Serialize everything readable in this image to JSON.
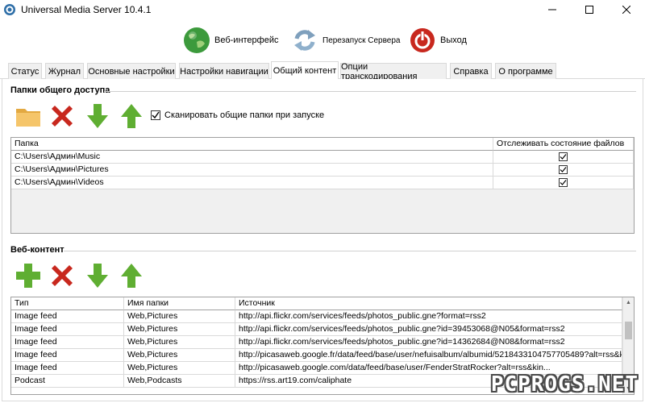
{
  "window": {
    "title": "Universal Media Server 10.4.1",
    "app_icon": "ums-icon"
  },
  "toolbar": {
    "web_label": "Веб-интерфейс",
    "restart_label": "Перезапуск Сервера",
    "exit_label": "Выход"
  },
  "tabs": [
    {
      "label": "Статус"
    },
    {
      "label": "Журнал"
    },
    {
      "label": "Основные настройки"
    },
    {
      "label": "Настройки навигации"
    },
    {
      "label": "Общий контент"
    },
    {
      "label": "Опции транскодирования"
    },
    {
      "label": "Справка"
    },
    {
      "label": "О программе"
    }
  ],
  "active_tab": "Общий контент",
  "shared_folders": {
    "section_title": "Папки общего доступа",
    "scan_label": "Сканировать общие папки при запуске",
    "scan_checked": true,
    "columns": [
      "Папка",
      "Отслеживать состояние файлов"
    ],
    "rows": [
      {
        "folder": "C:\\Users\\Админ\\Music",
        "monitor": true
      },
      {
        "folder": "C:\\Users\\Админ\\Pictures",
        "monitor": true
      },
      {
        "folder": "C:\\Users\\Админ\\Videos",
        "monitor": true
      }
    ]
  },
  "web_content": {
    "section_title": "Веб-контент",
    "columns": [
      "Тип",
      "Имя папки",
      "Источник"
    ],
    "rows": [
      {
        "type": "Image feed",
        "folder": "Web,Pictures",
        "source": "http://api.flickr.com/services/feeds/photos_public.gne?format=rss2"
      },
      {
        "type": "Image feed",
        "folder": "Web,Pictures",
        "source": "http://api.flickr.com/services/feeds/photos_public.gne?id=39453068@N05&format=rss2"
      },
      {
        "type": "Image feed",
        "folder": "Web,Pictures",
        "source": "http://api.flickr.com/services/feeds/photos_public.gne?id=14362684@N08&format=rss2"
      },
      {
        "type": "Image feed",
        "folder": "Web,Pictures",
        "source": "http://picasaweb.google.fr/data/feed/base/user/nefuisalbum/albumid/5218433104757705489?alt=rss&kin..."
      },
      {
        "type": "Image feed",
        "folder": "Web,Pictures",
        "source": "http://picasaweb.google.com/data/feed/base/user/FenderStratRocker?alt=rss&kin..."
      },
      {
        "type": "Podcast",
        "folder": "Web,Podcasts",
        "source": "https://rss.art19.com/caliphate"
      }
    ]
  },
  "watermark": "PCPROGS.NET",
  "colors": {
    "green_arrow": "#5fae32",
    "red_x": "#c8281e",
    "folder_yellow": "#f5c56a",
    "globe_green": "#3c9a3c"
  }
}
